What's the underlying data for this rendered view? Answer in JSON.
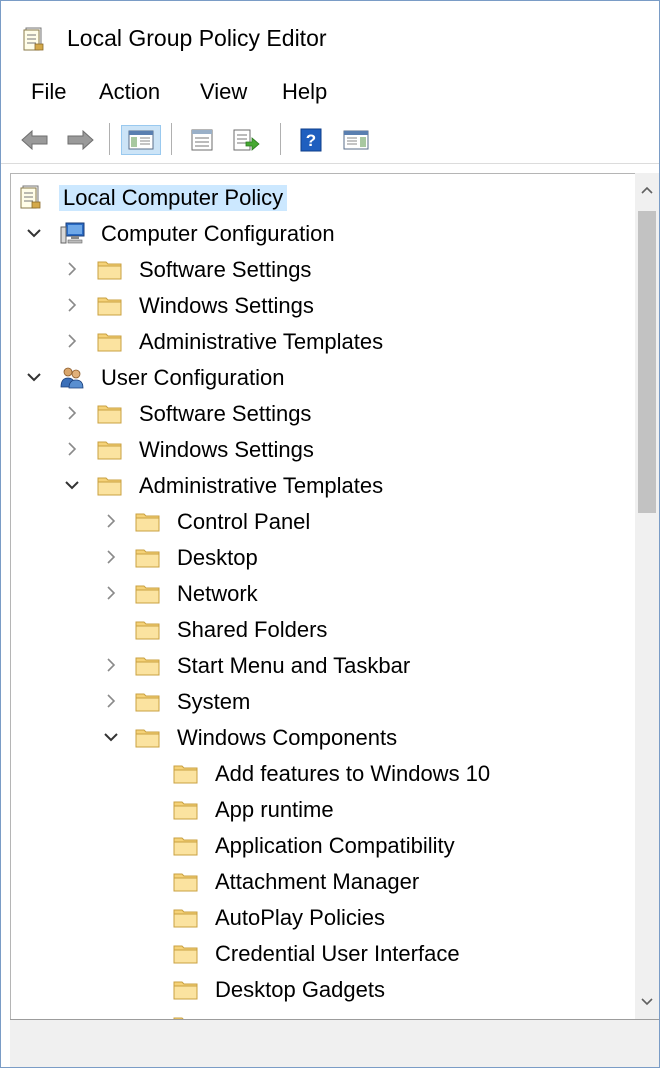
{
  "window": {
    "title": "Local Group Policy Editor"
  },
  "menu": [
    "File",
    "Action",
    "View",
    "Help"
  ],
  "toolbar": {
    "buttons": [
      "back-arrow",
      "forward-arrow",
      "show-hide-console-tree",
      "properties",
      "export-list",
      "help",
      "show-hide-action-pane"
    ]
  },
  "tree": {
    "root": "Local Computer Policy",
    "computer_configuration": {
      "label": "Computer Configuration",
      "children": [
        "Software Settings",
        "Windows Settings",
        "Administrative Templates"
      ]
    },
    "user_configuration": {
      "label": "User Configuration",
      "software_settings": "Software Settings",
      "windows_settings": "Windows Settings",
      "administrative_templates": {
        "label": "Administrative Templates",
        "children": [
          "Control Panel",
          "Desktop",
          "Network",
          "Shared Folders",
          "Start Menu and Taskbar",
          "System"
        ],
        "windows_components": {
          "label": "Windows Components",
          "children": [
            "Add features to Windows 10",
            "App runtime",
            "Application Compatibility",
            "Attachment Manager",
            "AutoPlay Policies",
            "Credential User Interface",
            "Desktop Gadgets"
          ]
        }
      }
    }
  },
  "colors": {
    "selection": "#cce8ff",
    "folder": "#f5d278",
    "window_border": "#7a9cc6"
  }
}
